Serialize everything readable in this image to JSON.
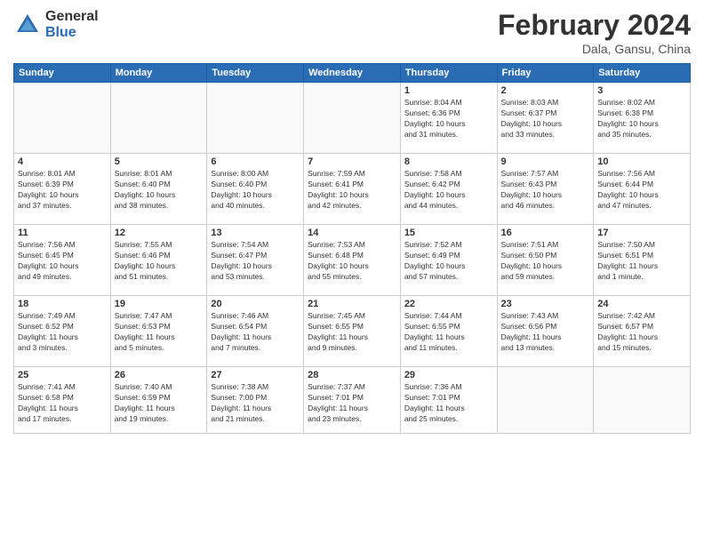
{
  "header": {
    "logo_general": "General",
    "logo_blue": "Blue",
    "month_year": "February 2024",
    "location": "Dala, Gansu, China"
  },
  "days_of_week": [
    "Sunday",
    "Monday",
    "Tuesday",
    "Wednesday",
    "Thursday",
    "Friday",
    "Saturday"
  ],
  "weeks": [
    [
      {
        "day": "",
        "info": ""
      },
      {
        "day": "",
        "info": ""
      },
      {
        "day": "",
        "info": ""
      },
      {
        "day": "",
        "info": ""
      },
      {
        "day": "1",
        "info": "Sunrise: 8:04 AM\nSunset: 6:36 PM\nDaylight: 10 hours\nand 31 minutes."
      },
      {
        "day": "2",
        "info": "Sunrise: 8:03 AM\nSunset: 6:37 PM\nDaylight: 10 hours\nand 33 minutes."
      },
      {
        "day": "3",
        "info": "Sunrise: 8:02 AM\nSunset: 6:38 PM\nDaylight: 10 hours\nand 35 minutes."
      }
    ],
    [
      {
        "day": "4",
        "info": "Sunrise: 8:01 AM\nSunset: 6:39 PM\nDaylight: 10 hours\nand 37 minutes."
      },
      {
        "day": "5",
        "info": "Sunrise: 8:01 AM\nSunset: 6:40 PM\nDaylight: 10 hours\nand 38 minutes."
      },
      {
        "day": "6",
        "info": "Sunrise: 8:00 AM\nSunset: 6:40 PM\nDaylight: 10 hours\nand 40 minutes."
      },
      {
        "day": "7",
        "info": "Sunrise: 7:59 AM\nSunset: 6:41 PM\nDaylight: 10 hours\nand 42 minutes."
      },
      {
        "day": "8",
        "info": "Sunrise: 7:58 AM\nSunset: 6:42 PM\nDaylight: 10 hours\nand 44 minutes."
      },
      {
        "day": "9",
        "info": "Sunrise: 7:57 AM\nSunset: 6:43 PM\nDaylight: 10 hours\nand 46 minutes."
      },
      {
        "day": "10",
        "info": "Sunrise: 7:56 AM\nSunset: 6:44 PM\nDaylight: 10 hours\nand 47 minutes."
      }
    ],
    [
      {
        "day": "11",
        "info": "Sunrise: 7:56 AM\nSunset: 6:45 PM\nDaylight: 10 hours\nand 49 minutes."
      },
      {
        "day": "12",
        "info": "Sunrise: 7:55 AM\nSunset: 6:46 PM\nDaylight: 10 hours\nand 51 minutes."
      },
      {
        "day": "13",
        "info": "Sunrise: 7:54 AM\nSunset: 6:47 PM\nDaylight: 10 hours\nand 53 minutes."
      },
      {
        "day": "14",
        "info": "Sunrise: 7:53 AM\nSunset: 6:48 PM\nDaylight: 10 hours\nand 55 minutes."
      },
      {
        "day": "15",
        "info": "Sunrise: 7:52 AM\nSunset: 6:49 PM\nDaylight: 10 hours\nand 57 minutes."
      },
      {
        "day": "16",
        "info": "Sunrise: 7:51 AM\nSunset: 6:50 PM\nDaylight: 10 hours\nand 59 minutes."
      },
      {
        "day": "17",
        "info": "Sunrise: 7:50 AM\nSunset: 6:51 PM\nDaylight: 11 hours\nand 1 minute."
      }
    ],
    [
      {
        "day": "18",
        "info": "Sunrise: 7:49 AM\nSunset: 6:52 PM\nDaylight: 11 hours\nand 3 minutes."
      },
      {
        "day": "19",
        "info": "Sunrise: 7:47 AM\nSunset: 6:53 PM\nDaylight: 11 hours\nand 5 minutes."
      },
      {
        "day": "20",
        "info": "Sunrise: 7:46 AM\nSunset: 6:54 PM\nDaylight: 11 hours\nand 7 minutes."
      },
      {
        "day": "21",
        "info": "Sunrise: 7:45 AM\nSunset: 6:55 PM\nDaylight: 11 hours\nand 9 minutes."
      },
      {
        "day": "22",
        "info": "Sunrise: 7:44 AM\nSunset: 6:55 PM\nDaylight: 11 hours\nand 11 minutes."
      },
      {
        "day": "23",
        "info": "Sunrise: 7:43 AM\nSunset: 6:56 PM\nDaylight: 11 hours\nand 13 minutes."
      },
      {
        "day": "24",
        "info": "Sunrise: 7:42 AM\nSunset: 6:57 PM\nDaylight: 11 hours\nand 15 minutes."
      }
    ],
    [
      {
        "day": "25",
        "info": "Sunrise: 7:41 AM\nSunset: 6:58 PM\nDaylight: 11 hours\nand 17 minutes."
      },
      {
        "day": "26",
        "info": "Sunrise: 7:40 AM\nSunset: 6:59 PM\nDaylight: 11 hours\nand 19 minutes."
      },
      {
        "day": "27",
        "info": "Sunrise: 7:38 AM\nSunset: 7:00 PM\nDaylight: 11 hours\nand 21 minutes."
      },
      {
        "day": "28",
        "info": "Sunrise: 7:37 AM\nSunset: 7:01 PM\nDaylight: 11 hours\nand 23 minutes."
      },
      {
        "day": "29",
        "info": "Sunrise: 7:36 AM\nSunset: 7:01 PM\nDaylight: 11 hours\nand 25 minutes."
      },
      {
        "day": "",
        "info": ""
      },
      {
        "day": "",
        "info": ""
      }
    ]
  ]
}
